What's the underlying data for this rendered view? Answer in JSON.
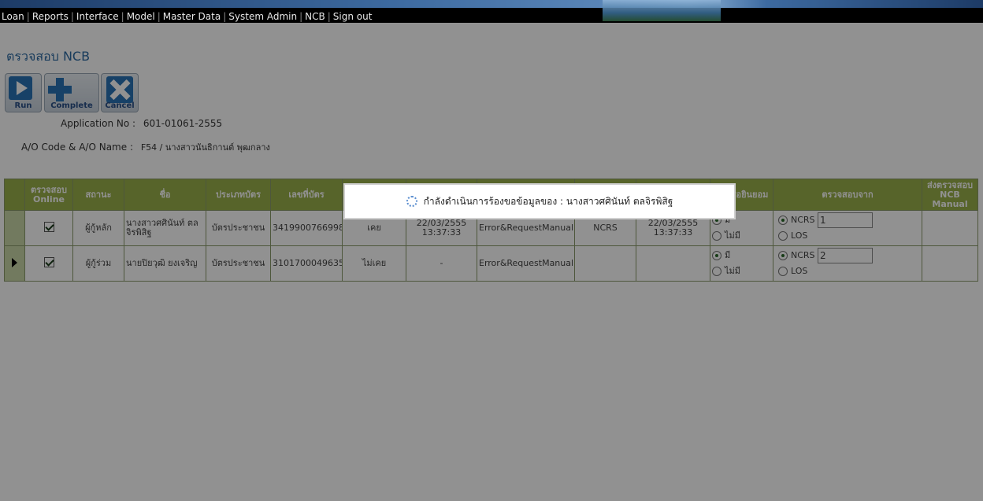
{
  "nav": {
    "items": [
      "Loan",
      "Reports",
      "Interface",
      "Model",
      "Master Data",
      "System Admin",
      "NCB",
      "Sign out"
    ]
  },
  "page": {
    "title": "ตรวจสอบ NCB"
  },
  "toolbar": {
    "run": "Run",
    "complete": "Complete",
    "cancel": "Cancel"
  },
  "info": {
    "app_no_label": "Application No :",
    "app_no_value": "601-01061-2555",
    "ao_label": "A/O Code & A/O Name :",
    "ao_value": "F54 / นางสาวนันธิกานต์ พุฒกลาง"
  },
  "table": {
    "headers": {
      "online": "ตรวจสอบ Online",
      "status": "สถานะ",
      "name": "ชื่อ",
      "card_type": "ประเภทบัตร",
      "card_no": "เลขที่บัตร",
      "consent": "หนังสือยินยอม",
      "source": "ตรวจสอบจาก",
      "manual": "ส่งตรวจสอบ NCB Manual"
    },
    "rows": [
      {
        "online": true,
        "status": "ผู้กู้หลัก",
        "name": "นางสาวศศินันท์ ตลจิรพิสิฐ",
        "card_type": "บัตรประชาชน",
        "card_no": "3419900766998",
        "history": "เคย",
        "date": "22/03/2555 13:37:33",
        "result": "Error&RequestManual",
        "from": "NCRS",
        "date2": "22/03/2555 13:37:33",
        "consent_yes": "มี",
        "consent_no": "ไม่มี",
        "consent_selected": "yes",
        "src_ncrs": "NCRS",
        "src_los": "LOS",
        "src_selected": "NCRS",
        "src_value": "1",
        "current": false
      },
      {
        "online": true,
        "status": "ผู้กู้ร่วม",
        "name": "นายปิยวุฒิ ยงเจริญ",
        "card_type": "บัตรประชาชน",
        "card_no": "3101700049635",
        "history": "ไม่เคย",
        "date": "-",
        "result": "Error&RequestManual",
        "from": "",
        "date2": "",
        "consent_yes": "มี",
        "consent_no": "ไม่มี",
        "consent_selected": "yes",
        "src_ncrs": "NCRS",
        "src_los": "LOS",
        "src_selected": "NCRS",
        "src_value": "2",
        "current": true
      }
    ]
  },
  "dialog": {
    "message": "กำลังดำเนินการร้องขอข้อมูลของ : นางสาวศศินันท์ ตลจิรพิสิฐ"
  }
}
